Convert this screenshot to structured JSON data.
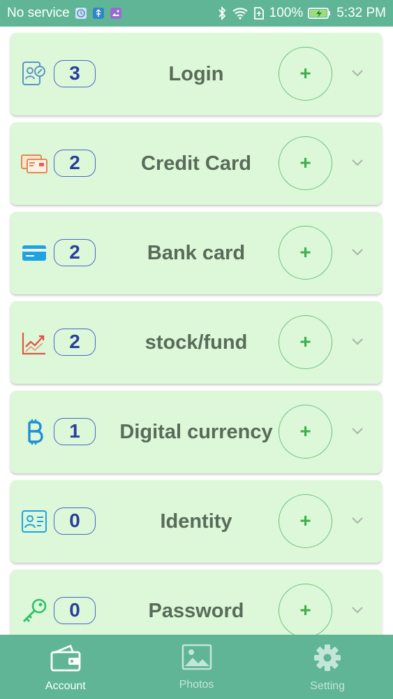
{
  "status_bar": {
    "carrier": "No service",
    "battery": "100%",
    "time": "5:32 PM",
    "icons": [
      "alarm-icon",
      "usb-icon",
      "gallery-icon",
      "bluetooth-icon",
      "wifi-icon",
      "sim-icon",
      "battery-icon"
    ]
  },
  "categories": [
    {
      "name": "Login",
      "count": "3",
      "icon": "login-icon",
      "add_label": "+"
    },
    {
      "name": "Credit Card",
      "count": "2",
      "icon": "credit-card-icon",
      "add_label": "+"
    },
    {
      "name": "Bank card",
      "count": "2",
      "icon": "bank-card-icon",
      "add_label": "+"
    },
    {
      "name": "stock/fund",
      "count": "2",
      "icon": "stock-fund-icon",
      "add_label": "+"
    },
    {
      "name": "Digital currency",
      "count": "1",
      "icon": "bitcoin-icon",
      "add_label": "+"
    },
    {
      "name": "Identity",
      "count": "0",
      "icon": "identity-icon",
      "add_label": "+"
    },
    {
      "name": "Password",
      "count": "0",
      "icon": "key-icon",
      "add_label": "+"
    }
  ],
  "bottom_nav": [
    {
      "label": "Account",
      "icon": "wallet-icon",
      "active": true
    },
    {
      "label": "Photos",
      "icon": "image-icon",
      "active": false
    },
    {
      "label": "Setting",
      "icon": "gear-icon",
      "active": false
    }
  ],
  "colors": {
    "accent": "#5fb596",
    "card_bg": "#dcf8d8",
    "count_border": "#4a65c8",
    "title_text": "#596b59",
    "add_green": "#3fae4f"
  }
}
